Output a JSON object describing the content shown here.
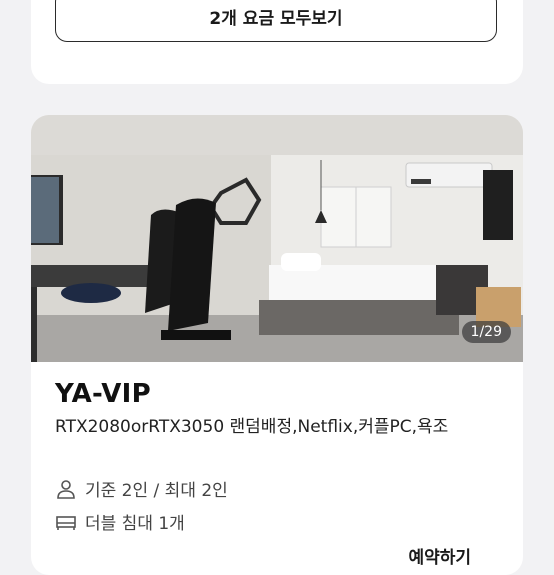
{
  "top_card": {
    "view_all_label": "2개 요금 모두보기"
  },
  "room": {
    "photo_counter": "1/29",
    "name": "YA-VIP",
    "description": "RTX2080orRTX3050 랜덤배정,Netflix,커플PC,욕조",
    "capacity": "기준 2인 / 최대 2인",
    "bed": "더블 침대 1개",
    "peek_text": "예약하기",
    "icons": {
      "capacity": "person-icon",
      "bed": "bed-icon"
    }
  }
}
